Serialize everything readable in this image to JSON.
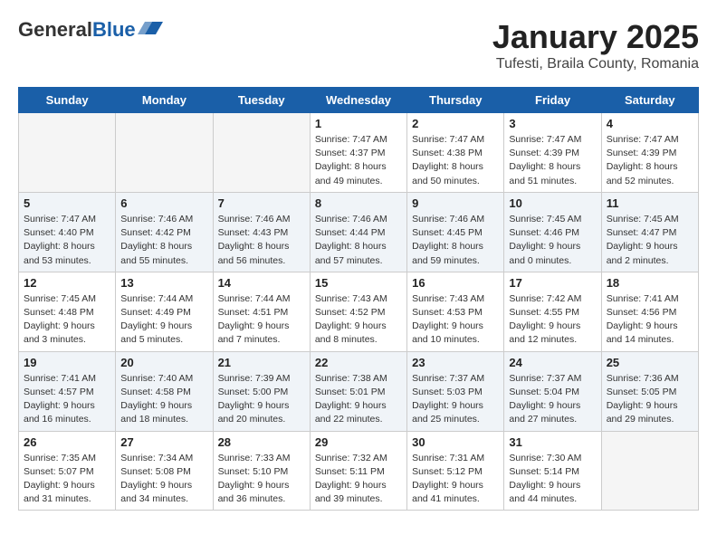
{
  "header": {
    "logo_general": "General",
    "logo_blue": "Blue",
    "title": "January 2025",
    "subtitle": "Tufesti, Braila County, Romania"
  },
  "weekdays": [
    "Sunday",
    "Monday",
    "Tuesday",
    "Wednesday",
    "Thursday",
    "Friday",
    "Saturday"
  ],
  "weeks": [
    [
      {
        "day": "",
        "info": ""
      },
      {
        "day": "",
        "info": ""
      },
      {
        "day": "",
        "info": ""
      },
      {
        "day": "1",
        "info": "Sunrise: 7:47 AM\nSunset: 4:37 PM\nDaylight: 8 hours\nand 49 minutes."
      },
      {
        "day": "2",
        "info": "Sunrise: 7:47 AM\nSunset: 4:38 PM\nDaylight: 8 hours\nand 50 minutes."
      },
      {
        "day": "3",
        "info": "Sunrise: 7:47 AM\nSunset: 4:39 PM\nDaylight: 8 hours\nand 51 minutes."
      },
      {
        "day": "4",
        "info": "Sunrise: 7:47 AM\nSunset: 4:39 PM\nDaylight: 8 hours\nand 52 minutes."
      }
    ],
    [
      {
        "day": "5",
        "info": "Sunrise: 7:47 AM\nSunset: 4:40 PM\nDaylight: 8 hours\nand 53 minutes."
      },
      {
        "day": "6",
        "info": "Sunrise: 7:46 AM\nSunset: 4:42 PM\nDaylight: 8 hours\nand 55 minutes."
      },
      {
        "day": "7",
        "info": "Sunrise: 7:46 AM\nSunset: 4:43 PM\nDaylight: 8 hours\nand 56 minutes."
      },
      {
        "day": "8",
        "info": "Sunrise: 7:46 AM\nSunset: 4:44 PM\nDaylight: 8 hours\nand 57 minutes."
      },
      {
        "day": "9",
        "info": "Sunrise: 7:46 AM\nSunset: 4:45 PM\nDaylight: 8 hours\nand 59 minutes."
      },
      {
        "day": "10",
        "info": "Sunrise: 7:45 AM\nSunset: 4:46 PM\nDaylight: 9 hours\nand 0 minutes."
      },
      {
        "day": "11",
        "info": "Sunrise: 7:45 AM\nSunset: 4:47 PM\nDaylight: 9 hours\nand 2 minutes."
      }
    ],
    [
      {
        "day": "12",
        "info": "Sunrise: 7:45 AM\nSunset: 4:48 PM\nDaylight: 9 hours\nand 3 minutes."
      },
      {
        "day": "13",
        "info": "Sunrise: 7:44 AM\nSunset: 4:49 PM\nDaylight: 9 hours\nand 5 minutes."
      },
      {
        "day": "14",
        "info": "Sunrise: 7:44 AM\nSunset: 4:51 PM\nDaylight: 9 hours\nand 7 minutes."
      },
      {
        "day": "15",
        "info": "Sunrise: 7:43 AM\nSunset: 4:52 PM\nDaylight: 9 hours\nand 8 minutes."
      },
      {
        "day": "16",
        "info": "Sunrise: 7:43 AM\nSunset: 4:53 PM\nDaylight: 9 hours\nand 10 minutes."
      },
      {
        "day": "17",
        "info": "Sunrise: 7:42 AM\nSunset: 4:55 PM\nDaylight: 9 hours\nand 12 minutes."
      },
      {
        "day": "18",
        "info": "Sunrise: 7:41 AM\nSunset: 4:56 PM\nDaylight: 9 hours\nand 14 minutes."
      }
    ],
    [
      {
        "day": "19",
        "info": "Sunrise: 7:41 AM\nSunset: 4:57 PM\nDaylight: 9 hours\nand 16 minutes."
      },
      {
        "day": "20",
        "info": "Sunrise: 7:40 AM\nSunset: 4:58 PM\nDaylight: 9 hours\nand 18 minutes."
      },
      {
        "day": "21",
        "info": "Sunrise: 7:39 AM\nSunset: 5:00 PM\nDaylight: 9 hours\nand 20 minutes."
      },
      {
        "day": "22",
        "info": "Sunrise: 7:38 AM\nSunset: 5:01 PM\nDaylight: 9 hours\nand 22 minutes."
      },
      {
        "day": "23",
        "info": "Sunrise: 7:37 AM\nSunset: 5:03 PM\nDaylight: 9 hours\nand 25 minutes."
      },
      {
        "day": "24",
        "info": "Sunrise: 7:37 AM\nSunset: 5:04 PM\nDaylight: 9 hours\nand 27 minutes."
      },
      {
        "day": "25",
        "info": "Sunrise: 7:36 AM\nSunset: 5:05 PM\nDaylight: 9 hours\nand 29 minutes."
      }
    ],
    [
      {
        "day": "26",
        "info": "Sunrise: 7:35 AM\nSunset: 5:07 PM\nDaylight: 9 hours\nand 31 minutes."
      },
      {
        "day": "27",
        "info": "Sunrise: 7:34 AM\nSunset: 5:08 PM\nDaylight: 9 hours\nand 34 minutes."
      },
      {
        "day": "28",
        "info": "Sunrise: 7:33 AM\nSunset: 5:10 PM\nDaylight: 9 hours\nand 36 minutes."
      },
      {
        "day": "29",
        "info": "Sunrise: 7:32 AM\nSunset: 5:11 PM\nDaylight: 9 hours\nand 39 minutes."
      },
      {
        "day": "30",
        "info": "Sunrise: 7:31 AM\nSunset: 5:12 PM\nDaylight: 9 hours\nand 41 minutes."
      },
      {
        "day": "31",
        "info": "Sunrise: 7:30 AM\nSunset: 5:14 PM\nDaylight: 9 hours\nand 44 minutes."
      },
      {
        "day": "",
        "info": ""
      }
    ]
  ]
}
